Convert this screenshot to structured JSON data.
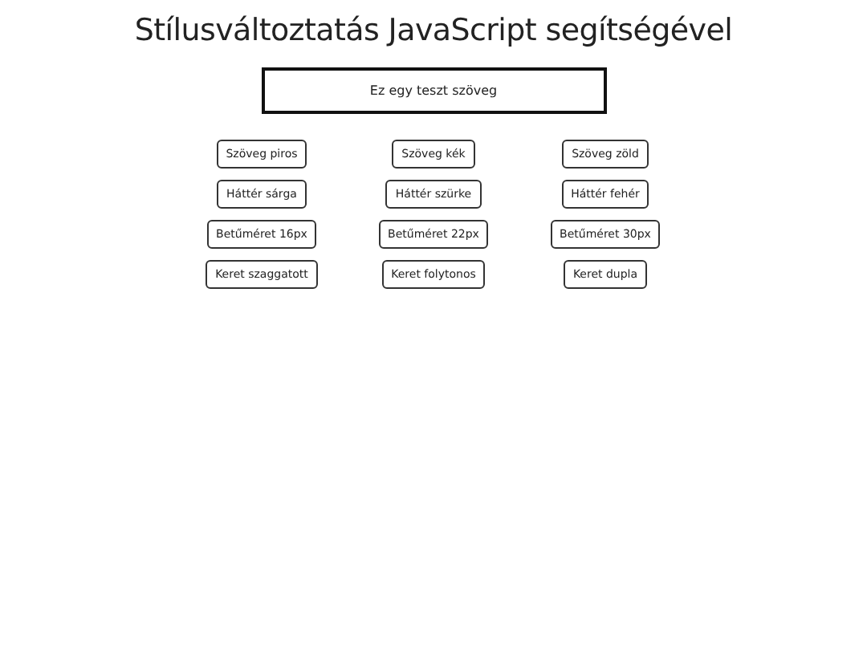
{
  "title": "Stílusváltoztatás JavaScript segítségével",
  "test_text": "Ez egy teszt szöveg",
  "buttons": [
    [
      "Szöveg piros",
      "Szöveg kék",
      "Szöveg zöld"
    ],
    [
      "Háttér sárga",
      "Háttér szürke",
      "Háttér fehér"
    ],
    [
      "Betűméret 16px",
      "Betűméret 22px",
      "Betűméret 30px"
    ],
    [
      "Keret szaggatott",
      "Keret folytonos",
      "Keret dupla"
    ]
  ]
}
